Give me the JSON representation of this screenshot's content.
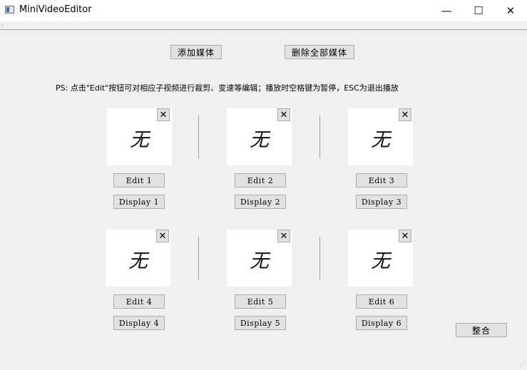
{
  "window": {
    "title": "MiniVideoEditor",
    "minimize_glyph": "—",
    "maximize_glyph": "☐",
    "close_glyph": "✕"
  },
  "toolbar": {
    "add_media_label": "添加媒体",
    "delete_all_label": "删除全部媒体"
  },
  "note": "PS: 点击\"Edit\"按钮可对相应子视频进行裁剪、变速等编辑；播放时空格键为暂停，ESC为退出播放",
  "slots": [
    {
      "glyph": "无",
      "edit_label": "Edit 1",
      "display_label": "Display 1",
      "close_glyph": "✕"
    },
    {
      "glyph": "无",
      "edit_label": "Edit 2",
      "display_label": "Display 2",
      "close_glyph": "✕"
    },
    {
      "glyph": "无",
      "edit_label": "Edit 3",
      "display_label": "Display 3",
      "close_glyph": "✕"
    },
    {
      "glyph": "无",
      "edit_label": "Edit 4",
      "display_label": "Display 4",
      "close_glyph": "✕"
    },
    {
      "glyph": "无",
      "edit_label": "Edit 5",
      "display_label": "Display 5",
      "close_glyph": "✕"
    },
    {
      "glyph": "无",
      "edit_label": "Edit 6",
      "display_label": "Display 6",
      "close_glyph": "✕"
    }
  ],
  "merge_label": "整合"
}
